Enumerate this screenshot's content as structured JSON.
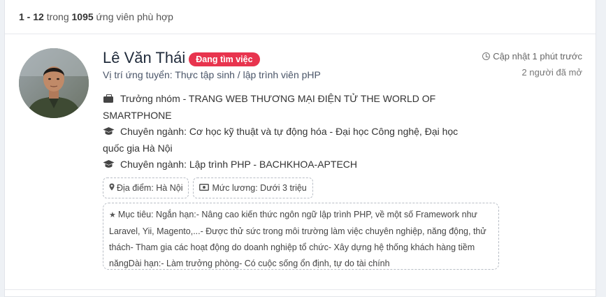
{
  "results": {
    "range": "1 - 12",
    "word_in": " trong ",
    "total": "1095",
    "suffix": " ứng viên phù hợp"
  },
  "candidate": {
    "name": "Lê Văn Thái",
    "status_badge": "Đang tìm việc",
    "position": "Vị trí ứng tuyển: Thực tập sinh / lập trình viên pHP",
    "updated": "Cập nhật 1 phút trước",
    "opened_by": "2 người đã mở",
    "details": [
      {
        "icon": "briefcase-icon",
        "text": "Trưởng nhóm - TRANG WEB THƯƠNG MẠI ĐIỆN TỬ THE WORLD OF SMARTPHONE"
      },
      {
        "icon": "graduation-cap-icon",
        "text": "Chuyên ngành: Cơ học kỹ thuật và tự động hóa - Đại học Công nghệ, Đại học quốc gia Hà Nội"
      },
      {
        "icon": "graduation-cap-icon",
        "text": "Chuyên ngành: Lập trình PHP - BACHKHOA-APTECH"
      }
    ],
    "location": "Địa điểm: Hà Nội",
    "salary": "Mức lương: Dưới 3 triệu",
    "goal": "Mục tiêu: Ngắn hạn:- Nâng cao kiến thức ngôn ngữ lập trình PHP, về một số Framework như Laravel, Yii, Magento,...- Được thử sức trong môi trường làm việc chuyên nghiệp, năng động, thử thách- Tham gia các hoạt động do doanh nghiệp tổ chức- Xây dựng hệ thống khách hàng tiềm năngDài hạn:- Làm trưởng phòng- Có cuộc sống ổn định, tự do tài chính"
  },
  "colors": {
    "badge": "#e8344e",
    "name": "#1f2a3a",
    "background": "#eef1f5"
  }
}
